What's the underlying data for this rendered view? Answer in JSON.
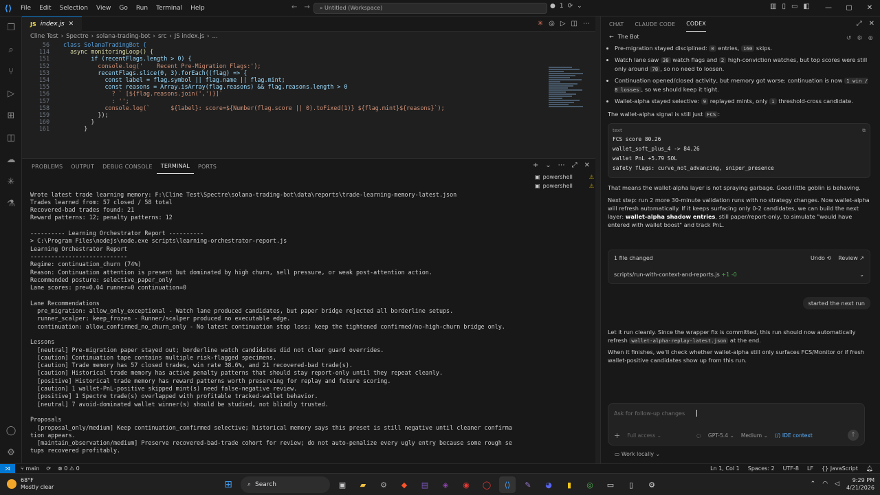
{
  "titlebar": {
    "menu": [
      "File",
      "Edit",
      "Selection",
      "View",
      "Go",
      "Run",
      "Terminal",
      "Help"
    ],
    "search": "Untitled (Workspace)",
    "badge": "1"
  },
  "editor": {
    "tab": "index.js",
    "breadcrumb": [
      "Cline Test",
      "Spectre",
      "solana-trading-bot",
      "src",
      "JS index.js",
      "..."
    ],
    "lines": [
      {
        "n": "56",
        "t": "class SolanaTradingBot {"
      },
      {
        "n": "114",
        "t": "  async monitoringLoop() {"
      },
      {
        "n": "151",
        "t": "        if (recentFlags.length > 0) {"
      },
      {
        "n": "152",
        "t": "          console.log('    Recent Pre-Migration Flags:');"
      },
      {
        "n": "153",
        "t": "          recentFlags.slice(0, 3).forEach((flag) => {"
      },
      {
        "n": "154",
        "t": "            const label = flag.symbol || flag.name || flag.mint;"
      },
      {
        "n": "155",
        "t": "            const reasons = Array.isArray(flag.reasons) && flag.reasons.length > 0"
      },
      {
        "n": "156",
        "t": "              ? ` [${flag.reasons.join(',')}]`"
      },
      {
        "n": "157",
        "t": "              : '';"
      },
      {
        "n": "158",
        "t": "            console.log(`      ${label}: score=${Number(flag.score || 0).toFixed(1)} ${flag.mint}${reasons}`);"
      },
      {
        "n": "159",
        "t": "          });"
      },
      {
        "n": "160",
        "t": "        }"
      },
      {
        "n": "161",
        "t": "      }"
      }
    ]
  },
  "panel": {
    "tabs": [
      "PROBLEMS",
      "OUTPUT",
      "DEBUG CONSOLE",
      "TERMINAL",
      "PORTS"
    ],
    "active_tab": "TERMINAL",
    "terminals": [
      "powershell",
      "powershell"
    ],
    "output": [
      "Wrote latest trade learning memory: F:\\Cline Test\\Spectre\\solana-trading-bot\\data\\reports\\trade-learning-memory-latest.json",
      "Trades learned from: 57 closed / 58 total",
      "Recovered-bad trades found: 21",
      "Reward patterns: 12; penalty patterns: 12",
      "",
      "---------- Learning Orchestrator Report ----------",
      "> C:\\Program Files\\nodejs\\node.exe scripts\\learning-orchestrator-report.js",
      "Learning Orchestrator Report",
      "----------------------------",
      "Regime: continuation_churn (74%)",
      "Reason: Continuation attention is present but dominated by high churn, sell pressure, or weak post-attention action.",
      "Recommended posture: selective_paper_only",
      "Lane scores: pre=0.04 runner=0 continuation=0",
      "",
      "Lane Recommendations",
      "  pre_migration: allow_only_exceptional - Watch lane produced candidates, but paper bridge rejected all borderline setups.",
      "  runner_scalper: keep_frozen - Runner/scalper produced no executable edge.",
      "  continuation: allow_confirmed_no_churn_only - No latest continuation stop loss; keep the tightened confirmed/no-high-churn bridge only.",
      "",
      "Lessons",
      "  [neutral] Pre-migration paper stayed out; borderline watch candidates did not clear guard overrides.",
      "  [caution] Continuation tape contains multiple risk-flagged specimens.",
      "  [caution] Trade memory has 57 closed trades, win rate 38.6%, and 21 recovered-bad trade(s).",
      "  [caution] Historical trade memory has active penalty patterns that should stay report-only until they repeat cleanly.",
      "  [positive] Historical trade memory has reward patterns worth preserving for replay and future scoring.",
      "  [caution] 1 wallet-PnL-positive skipped mint(s) need false-negative review.",
      "  [positive] 1 Spectre trade(s) overlapped with profitable tracked-wallet behavior.",
      "  [neutral] 7 avoid-dominated wallet winner(s) should be studied, not blindly trusted.",
      "",
      "Proposals",
      "  [proposal_only/medium] Keep continuation_confirmed selective; historical memory says this preset is still negative until cleaner confirma",
      "tion appears.",
      "  [maintain_observation/medium] Preserve recovered-bad-trade cohort for review; do not auto-penalize every ugly entry because some rough se",
      "tups recovered profitably.",
      "",
      "Wrote JSON report: F:\\Cline Test\\Spectre\\solana-trading-bot\\data\\reports\\learning-orchestrator-latest.json",
      "PS F:\\Cline Test\\Spectre\\solana-trading-bot> "
    ]
  },
  "chat": {
    "tabs": [
      "CHAT",
      "CLAUDE CODE",
      "CODEX"
    ],
    "active_tab": "CODEX",
    "thread_title": "The Bot",
    "bullets": [
      {
        "a": "Pre-migration stayed disciplined: ",
        "p1": "0",
        "b": " entries, ",
        "p2": "160",
        "c": " skips."
      },
      {
        "a": "Watch lane saw ",
        "p1": "38",
        "b": " watch flags and ",
        "p2": "2",
        "c": " high-conviction watches, but top scores were still only around ",
        "p3": "78",
        "d": ", so no need to loosen."
      },
      {
        "a": "Continuation opened/closed activity, but memory got worse: continuation is now ",
        "p1": "1 win / 8 losses",
        "b": ", so we should keep it tight."
      },
      {
        "a": "Wallet-alpha stayed selective: ",
        "p1": "9",
        "b": " replayed mints, only ",
        "p2": "1",
        "c": " threshold-cross candidate."
      }
    ],
    "signal_intro_a": "The wallet-alpha signal is still just ",
    "signal_intro_pill": "FCS",
    "signal_intro_b": ":",
    "code_lang": "text",
    "code_lines": [
      "FCS score 80.26",
      "wallet_soft_plus_4 -> 84.26",
      "wallet PnL +5.79 SOL",
      "safety flags: curve_not_advancing, sniper_presence"
    ],
    "para1": "That means the wallet-alpha layer is not spraying garbage. Good little goblin is behaving.",
    "para2_a": "Next step: run 2 more 30-minute validation runs with no strategy changes. Now wallet-alpha will refresh automatically. If it keeps surfacing only 0-2 candidates, we can build the next layer: ",
    "para2_bold": "wallet-alpha shadow entries",
    "para2_b": ", still paper/report-only, to simulate \"would have entered with wallet boost\" and track PnL.",
    "files_changed": "1 file changed",
    "undo": "Undo",
    "review": "Review",
    "file_name": "scripts/run-with-context-and-reports.js",
    "file_diff": "+1 -0",
    "user_msg": "started the next run",
    "para3_a": "Let it run cleanly. Since the wrapper fix is committed, this run should now automatically refresh ",
    "para3_pill": "wallet-alpha-replay-latest.json",
    "para3_b": " at the end.",
    "para4": "When it finishes, we'll check whether wallet-alpha still only surfaces FCS/Monitor or if fresh wallet-positive candidates show up from this run.",
    "composer_placeholder": "Ask for follow-up changes",
    "access": "Full access",
    "model": "GPT-5.4",
    "effort": "Medium",
    "ide_context": "IDE context",
    "work_locally": "Work locally"
  },
  "status": {
    "branch": "main",
    "errors": "0",
    "warnings": "0",
    "position": "Ln 1, Col 1",
    "spaces": "Spaces: 2",
    "encoding": "UTF-8",
    "eol": "LF",
    "language": "JavaScript"
  },
  "taskbar": {
    "temp": "68°F",
    "weather": "Mostly clear",
    "search": "Search",
    "time": "9:29 PM",
    "date": "4/21/2026"
  }
}
